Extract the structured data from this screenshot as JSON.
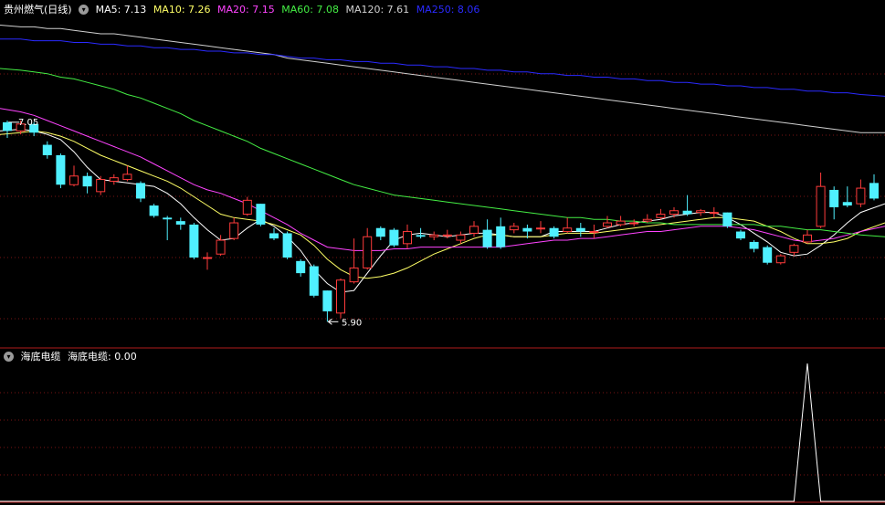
{
  "colors": {
    "background": "#000000",
    "up": "#ff3b3b",
    "down": "#4ff0ff",
    "grid": "#7a1414",
    "panel_border": "#b01c1c",
    "ma5": "#ffffff",
    "ma10": "#ffff66",
    "ma20": "#ff44ff",
    "ma60": "#44ee44",
    "ma120": "#d0d0d0",
    "ma250": "#2a2aff",
    "indicator": "#ffffff"
  },
  "main_header": {
    "collapse_icon": "chevron-down-icon",
    "title": "贵州燃气(日线)",
    "ma5": "MA5: 7.13",
    "ma10": "MA10: 7.26",
    "ma20": "MA20: 7.15",
    "ma60": "MA60: 7.08",
    "ma120": "MA120: 7.61",
    "ma250": "MA250: 8.06"
  },
  "indicator_header": {
    "collapse_icon": "chevron-down-icon",
    "name": "海底电缆",
    "value_label": "海底电缆: 0.00"
  },
  "annotations": {
    "high_label": "7.05",
    "low_label": "5.90"
  },
  "chart_data": [
    {
      "type": "candlestick",
      "title": "贵州燃气(日线)",
      "ylim": [
        5.77,
        7.66
      ],
      "annotations": [
        {
          "text": "7.05",
          "at_index": 2,
          "kind": "high"
        },
        {
          "text": "5.90",
          "at_index": 24,
          "kind": "low"
        }
      ],
      "candles": [
        [
          7.05,
          7.0,
          7.06,
          6.96
        ],
        [
          7.0,
          7.04,
          7.06,
          6.98
        ],
        [
          7.04,
          6.99,
          7.05,
          6.97
        ],
        [
          6.92,
          6.86,
          6.94,
          6.84
        ],
        [
          6.86,
          6.69,
          6.87,
          6.67
        ],
        [
          6.69,
          6.74,
          6.8,
          6.68
        ],
        [
          6.74,
          6.68,
          6.76,
          6.64
        ],
        [
          6.65,
          6.72,
          6.74,
          6.63
        ],
        [
          6.71,
          6.73,
          6.75,
          6.69
        ],
        [
          6.72,
          6.75,
          6.8,
          6.71
        ],
        [
          6.7,
          6.61,
          6.71,
          6.59
        ],
        [
          6.57,
          6.51,
          6.58,
          6.5
        ],
        [
          6.5,
          6.49,
          6.51,
          6.37
        ],
        [
          6.48,
          6.46,
          6.5,
          6.43
        ],
        [
          6.46,
          6.27,
          6.47,
          6.26
        ],
        [
          6.27,
          6.27,
          6.3,
          6.2
        ],
        [
          6.29,
          6.37,
          6.4,
          6.28
        ],
        [
          6.38,
          6.47,
          6.5,
          6.37
        ],
        [
          6.52,
          6.6,
          6.62,
          6.51
        ],
        [
          6.58,
          6.46,
          6.58,
          6.45
        ],
        [
          6.41,
          6.38,
          6.44,
          6.37
        ],
        [
          6.41,
          6.27,
          6.42,
          6.26
        ],
        [
          6.25,
          6.18,
          6.26,
          6.16
        ],
        [
          6.22,
          6.05,
          6.23,
          6.04
        ],
        [
          6.08,
          5.96,
          6.08,
          5.9
        ],
        [
          5.95,
          6.14,
          6.15,
          5.92
        ],
        [
          6.13,
          6.21,
          6.38,
          6.12
        ],
        [
          6.21,
          6.39,
          6.44,
          6.2
        ],
        [
          6.44,
          6.39,
          6.45,
          6.37
        ],
        [
          6.43,
          6.34,
          6.44,
          6.33
        ],
        [
          6.35,
          6.42,
          6.46,
          6.32
        ],
        [
          6.4,
          6.39,
          6.44,
          6.38
        ],
        [
          6.39,
          6.4,
          6.42,
          6.37
        ],
        [
          6.4,
          6.4,
          6.43,
          6.38
        ],
        [
          6.37,
          6.4,
          6.42,
          6.35
        ],
        [
          6.41,
          6.45,
          6.48,
          6.39
        ],
        [
          6.43,
          6.33,
          6.49,
          6.32
        ],
        [
          6.45,
          6.33,
          6.5,
          6.32
        ],
        [
          6.43,
          6.45,
          6.47,
          6.41
        ],
        [
          6.44,
          6.42,
          6.46,
          6.38
        ],
        [
          6.44,
          6.44,
          6.48,
          6.41
        ],
        [
          6.44,
          6.39,
          6.45,
          6.38
        ],
        [
          6.42,
          6.44,
          6.5,
          6.41
        ],
        [
          6.44,
          6.42,
          6.47,
          6.39
        ],
        [
          6.42,
          6.42,
          6.46,
          6.38
        ],
        [
          6.45,
          6.47,
          6.51,
          6.44
        ],
        [
          6.46,
          6.48,
          6.51,
          6.45
        ],
        [
          6.47,
          6.47,
          6.49,
          6.45
        ],
        [
          6.48,
          6.49,
          6.52,
          6.47
        ],
        [
          6.5,
          6.52,
          6.55,
          6.49
        ],
        [
          6.52,
          6.54,
          6.56,
          6.5
        ],
        [
          6.54,
          6.52,
          6.63,
          6.51
        ],
        [
          6.53,
          6.54,
          6.55,
          6.51
        ],
        [
          6.53,
          6.53,
          6.56,
          6.5
        ],
        [
          6.53,
          6.45,
          6.53,
          6.44
        ],
        [
          6.42,
          6.38,
          6.43,
          6.37
        ],
        [
          6.36,
          6.32,
          6.37,
          6.3
        ],
        [
          6.33,
          6.24,
          6.34,
          6.23
        ],
        [
          6.24,
          6.28,
          6.29,
          6.23
        ],
        [
          6.3,
          6.34,
          6.35,
          6.28
        ],
        [
          6.36,
          6.4,
          6.43,
          6.35
        ],
        [
          6.45,
          6.68,
          6.76,
          6.44
        ],
        [
          6.66,
          6.56,
          6.68,
          6.49
        ],
        [
          6.59,
          6.57,
          6.68,
          6.56
        ],
        [
          6.58,
          6.67,
          6.72,
          6.56
        ],
        [
          6.7,
          6.61,
          6.75,
          6.6
        ]
      ],
      "series": [
        {
          "name": "MA5",
          "values": [
            7.0,
            7.01,
            7.0,
            6.98,
            6.95,
            6.88,
            6.79,
            6.72,
            6.71,
            6.7,
            6.69,
            6.68,
            6.64,
            6.58,
            6.5,
            6.43,
            6.37,
            6.38,
            6.44,
            6.49,
            6.45,
            6.39,
            6.31,
            6.2,
            6.12,
            6.07,
            6.08,
            6.18,
            6.28,
            6.37,
            6.4,
            6.41,
            6.4,
            6.39,
            6.4,
            6.41,
            6.41,
            6.4,
            6.39,
            6.39,
            6.39,
            6.42,
            6.42,
            6.42,
            6.42,
            6.44,
            6.46,
            6.47,
            6.48,
            6.49,
            6.51,
            6.52,
            6.53,
            6.53,
            6.5,
            6.46,
            6.41,
            6.36,
            6.3,
            6.28,
            6.29,
            6.34,
            6.4,
            6.47,
            6.53,
            6.58
          ]
        },
        {
          "name": "MA10",
          "values": [
            6.98,
            6.99,
            7.0,
            6.99,
            6.97,
            6.94,
            6.9,
            6.86,
            6.83,
            6.8,
            6.77,
            6.74,
            6.71,
            6.67,
            6.62,
            6.57,
            6.52,
            6.5,
            6.49,
            6.48,
            6.46,
            6.43,
            6.4,
            6.34,
            6.26,
            6.2,
            6.16,
            6.15,
            6.16,
            6.18,
            6.21,
            6.25,
            6.29,
            6.32,
            6.35,
            6.38,
            6.4,
            6.4,
            6.39,
            6.39,
            6.39,
            6.4,
            6.41,
            6.41,
            6.41,
            6.42,
            6.43,
            6.44,
            6.45,
            6.46,
            6.47,
            6.48,
            6.49,
            6.5,
            6.5,
            6.49,
            6.48,
            6.45,
            6.42,
            6.38,
            6.35,
            6.35,
            6.36,
            6.38,
            6.42,
            6.47
          ]
        },
        {
          "name": "MA20",
          "values": [
            7.13,
            7.11,
            7.09,
            7.06,
            7.03,
            7.0,
            6.97,
            6.94,
            6.91,
            6.88,
            6.85,
            6.81,
            6.77,
            6.73,
            6.69,
            6.66,
            6.64,
            6.61,
            6.58,
            6.54,
            6.5,
            6.46,
            6.41,
            6.37,
            6.33,
            6.32,
            6.31,
            6.31,
            6.31,
            6.32,
            6.32,
            6.33,
            6.33,
            6.33,
            6.33,
            6.33,
            6.33,
            6.33,
            6.34,
            6.35,
            6.36,
            6.37,
            6.37,
            6.38,
            6.38,
            6.39,
            6.4,
            6.41,
            6.42,
            6.42,
            6.43,
            6.44,
            6.45,
            6.45,
            6.45,
            6.44,
            6.43,
            6.41,
            6.39,
            6.37,
            6.36,
            6.37,
            6.38,
            6.4,
            6.42,
            6.45
          ]
        },
        {
          "name": "MA60",
          "values": [
            7.36,
            7.35,
            7.34,
            7.33,
            7.31,
            7.3,
            7.28,
            7.26,
            7.24,
            7.21,
            7.19,
            7.16,
            7.13,
            7.1,
            7.06,
            7.03,
            7.0,
            6.97,
            6.94,
            6.9,
            6.87,
            6.84,
            6.81,
            6.78,
            6.75,
            6.72,
            6.69,
            6.67,
            6.65,
            6.63,
            6.62,
            6.61,
            6.6,
            6.59,
            6.58,
            6.57,
            6.56,
            6.55,
            6.54,
            6.53,
            6.52,
            6.51,
            6.5,
            6.5,
            6.49,
            6.49,
            6.48,
            6.48,
            6.47,
            6.47,
            6.46,
            6.46,
            6.46,
            6.46,
            6.46,
            6.46,
            6.46,
            6.45,
            6.45,
            6.44,
            6.43,
            6.43,
            6.42,
            6.41,
            6.4,
            6.39
          ]
        },
        {
          "name": "MA120",
          "values": [
            7.61,
            7.6,
            7.6,
            7.59,
            7.59,
            7.58,
            7.57,
            7.56,
            7.56,
            7.55,
            7.54,
            7.53,
            7.52,
            7.51,
            7.5,
            7.49,
            7.48,
            7.47,
            7.46,
            7.45,
            7.44,
            7.42,
            7.41,
            7.4,
            7.39,
            7.38,
            7.37,
            7.36,
            7.35,
            7.34,
            7.33,
            7.32,
            7.31,
            7.3,
            7.29,
            7.28,
            7.27,
            7.26,
            7.25,
            7.24,
            7.23,
            7.22,
            7.21,
            7.2,
            7.19,
            7.18,
            7.17,
            7.16,
            7.15,
            7.14,
            7.13,
            7.12,
            7.11,
            7.1,
            7.09,
            7.08,
            7.07,
            7.06,
            7.05,
            7.04,
            7.03,
            7.02,
            7.01,
            7.0,
            6.99,
            6.99
          ]
        },
        {
          "name": "MA250",
          "values": [
            7.53,
            7.53,
            7.52,
            7.52,
            7.52,
            7.51,
            7.51,
            7.5,
            7.5,
            7.49,
            7.49,
            7.48,
            7.48,
            7.47,
            7.47,
            7.46,
            7.46,
            7.45,
            7.45,
            7.44,
            7.44,
            7.43,
            7.42,
            7.42,
            7.41,
            7.41,
            7.4,
            7.4,
            7.39,
            7.39,
            7.38,
            7.38,
            7.37,
            7.37,
            7.36,
            7.36,
            7.35,
            7.35,
            7.34,
            7.34,
            7.33,
            7.33,
            7.32,
            7.32,
            7.31,
            7.31,
            7.3,
            7.3,
            7.29,
            7.29,
            7.28,
            7.28,
            7.27,
            7.27,
            7.26,
            7.26,
            7.25,
            7.25,
            7.24,
            7.24,
            7.23,
            7.23,
            7.22,
            7.22,
            7.21,
            7.2
          ]
        }
      ]
    },
    {
      "type": "line",
      "title": "海底电缆",
      "ylim": [
        0,
        1
      ],
      "series": [
        {
          "name": "海底电缆",
          "values": [
            0,
            0,
            0,
            0,
            0,
            0,
            0,
            0,
            0,
            0,
            0,
            0,
            0,
            0,
            0,
            0,
            0,
            0,
            0,
            0,
            0,
            0,
            0,
            0,
            0,
            0,
            0,
            0,
            0,
            0,
            0,
            0,
            0,
            0,
            0,
            0,
            0,
            0,
            0,
            0,
            0,
            0,
            0,
            0,
            0,
            0,
            0,
            0,
            0,
            0,
            0,
            0,
            0,
            0,
            0,
            0,
            0,
            0,
            0,
            0,
            1,
            0,
            0,
            0,
            0,
            0
          ]
        }
      ]
    }
  ]
}
